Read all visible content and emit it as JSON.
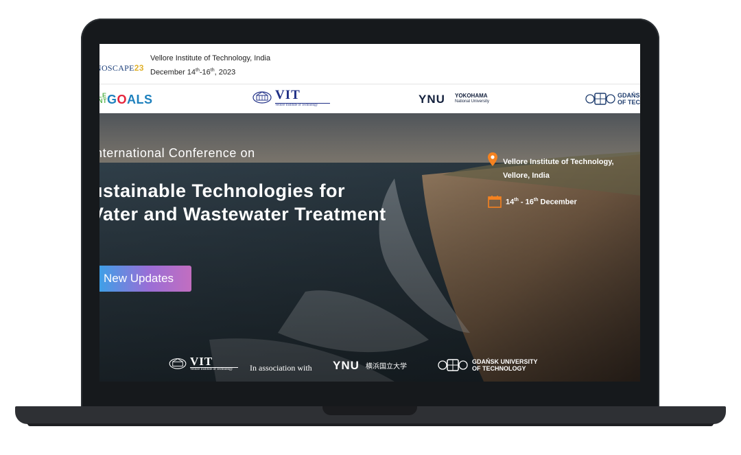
{
  "header": {
    "brand_name": "NOSCAPE",
    "brand_mark": "23",
    "venue": "Vellore Institute of Technology, India",
    "dates_prefix": "December 14",
    "dates_sup1": "th",
    "dates_mid": "-16",
    "dates_sup2": "th",
    "dates_suffix": ", 2023"
  },
  "logos": {
    "sdg_small": "LE\nNT",
    "sdg_text": "GOALS",
    "vit_text": "VIT",
    "vit_sub": "Vellore Institute of Technology",
    "ynu_text": "YNU",
    "ynu_name1": "YOKOHAMA",
    "ynu_name2": "National University",
    "gdansk_line1": "GDAŃSK",
    "gdansk_line2": "OF TECH"
  },
  "hero": {
    "kicker": "nternational Conference on",
    "title_line1": "ustainable Technologies for",
    "title_line2": "Vater and Wastewater Treatment",
    "button_label": "New Updates",
    "location_line1": "Vellore Institute of Technology,",
    "location_line2": "Vellore, India",
    "date_start": "14",
    "date_start_sup": "th",
    "date_mid": " - 16",
    "date_end_sup": "th",
    "date_suffix": " December"
  },
  "footer": {
    "vit_text": "VIT",
    "vit_sub": "Vellore Institute of Technology",
    "association": "In association with",
    "ynu_text": "YNU",
    "ynu_kanji": "横浜国立大学",
    "gdansk_line1": "GDAŃSK UNIVERSITY",
    "gdansk_line2": "OF TECHNOLOGY"
  },
  "colors": {
    "accent_orange": "#f58220",
    "button_gradient_start": "#3aa2e8",
    "button_gradient_end": "#c26ec0"
  }
}
